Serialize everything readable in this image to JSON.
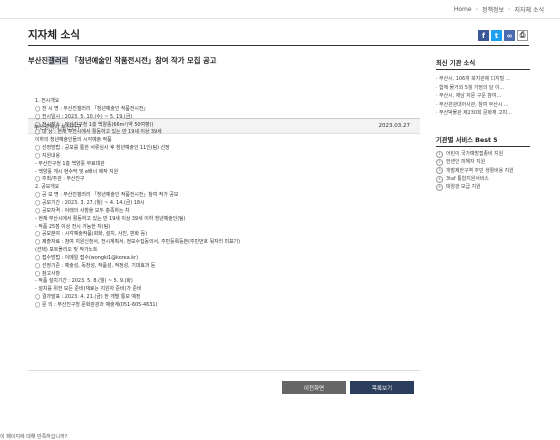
{
  "breadcrumb": {
    "home": "Home",
    "section": "정책정보",
    "current": "지자체 소식"
  },
  "page_title": "지자체 소식",
  "share": {
    "facebook": "f",
    "twitter": "t",
    "link": "∞",
    "print": "⎙"
  },
  "post": {
    "title_prefix": "부산진",
    "title_highlight": "갤러리",
    "title_suffix": " 「청년예술인 작품전시전」참여 작가 모집 공고",
    "author": "부산광역시 부산진구",
    "date": "2023.03.27",
    "body_lines": [
      "1. 전시개요",
      "◯ 전 시 명 : 부산진갤러리 「청년예술인 작품전시전」",
      "◯ 전시일시 : 2023. 5. 10.(수) ~ 5. 19.(금)",
      "◯ 전시장소 : 부산진구청 1층 백양홀(66m²(약 50여평))",
      "◯ 대 상 : 현재 부산시에서 활동하고 있는 만 19세 이상 39세",
      "  이하의 청년예술인들의 시각예술 작품",
      "◯ 선정방법 : 공모를 통한 서류심사 후 청년예술인 11인(팀) 선정",
      "◯ 지원내용",
      "  - 부산진구청 1층 백양홀 무료대관",
      "  - 백양홀 게시 현수막 및 e배너 제작 지원",
      "◯ 주최/주관 : 부산진구",
      "2. 공모개요",
      "◯ 공 모 명 : 부산진갤러리 「청년예술인 작품전시전」참여 작가 공모",
      "◯ 공모기간 : 2023. 3. 27.(월) ~ 4. 14.(금) 18시",
      "◯ 공모자격 : 아래의 사항을 모두 충족하는 자",
      "  - 현재 부산시에서 활동하고 있는 만 19세 이상 39세 이하 청년예술인(팀)",
      "  - 작품 25점 이상 전시 가능한 자(팀)",
      "◯ 공모분야 : 시각예술작품(회화, 설치, 사진, 판화 등)",
      "◯ 제출자료 : 참여 지원신청서, 전시계획서, 정보수집동의서, 주민등록등본(주민번호 뒷자리 미표기)",
      "  (선택) 포트폴리오 및 작가노트",
      "◯ 접수방법 : 이메일 접수(wongki1@korea.kr)",
      "◯ 선정기준 : 예술성, 독창성, 작품성, 적정성, 기대효과 등",
      "◯ 참고사항",
      "  - 작품 설치기간 : 2023. 5. 8.(월) ~ 5. 9.(화)",
      "  - 설치를 위한 모든 준비(재료는 지원자 준비)가 준비",
      "◯ 결과발표 : 2023. 4. 21.(금) 한 개별 통보 예정",
      "◯ 문 의 : 부산진구청 문화관광과 예술계(051-605-4631)"
    ]
  },
  "buttons": {
    "prev": "이전화면",
    "list": "목록보기"
  },
  "sidebar": {
    "recent_title": "최신 기관 소식",
    "recent_items": [
      "부산시, 106개 복지관에 디지털 ...",
      "함께 물거외 5월 가정의 달 이...",
      "부산시, 재남 자문 구운 참여...",
      "부산관광대어사관, 참여 부산시 ...",
      "부산박물관 제230회 문화재 고피..."
    ],
    "best_title": "기관별 서비스 Best 5",
    "best_items": [
      "어린이 국가예방접종비 지원",
      "한센인 피해자 지원",
      "개발제한구역 주민 생활비용 지원",
      "3taf 통합지원서비스",
      "태양광 보급 지원"
    ]
  },
  "footer_text": "이 페이지에 대해 만족하십니까?"
}
